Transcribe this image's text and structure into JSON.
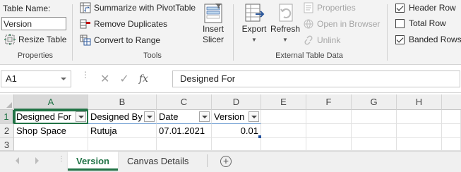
{
  "ribbon": {
    "properties": {
      "table_name_label": "Table Name:",
      "table_name_value": "Version",
      "resize_table": "Resize Table",
      "group_label": "Properties"
    },
    "tools": {
      "summarize_pivot": "Summarize with PivotTable",
      "remove_duplicates": "Remove Duplicates",
      "convert_to_range": "Convert to Range",
      "insert_slicer_line1": "Insert",
      "insert_slicer_line2": "Slicer",
      "group_label": "Tools"
    },
    "external": {
      "export": "Export",
      "refresh": "Refresh",
      "properties": "Properties",
      "open_in_browser": "Open in Browser",
      "unlink": "Unlink",
      "group_label": "External Table Data"
    },
    "style_options": {
      "header_row": {
        "label": "Header Row",
        "checked": true
      },
      "total_row": {
        "label": "Total Row",
        "checked": false
      },
      "banded_rows": {
        "label": "Banded Rows",
        "checked": true
      }
    }
  },
  "formula_bar": {
    "name_box": "A1",
    "fx_symbol": "fx",
    "cancel_symbol": "✕",
    "enter_symbol": "✓",
    "content": "Designed For"
  },
  "grid": {
    "columns": [
      "A",
      "B",
      "C",
      "D",
      "E",
      "F",
      "G",
      "H"
    ],
    "rows": [
      "1",
      "2",
      "3"
    ],
    "header_row": [
      "Designed For",
      "Designed By",
      "Date",
      "Version"
    ],
    "data_row": [
      "Shop Space",
      "Rutuja",
      "07.01.2021",
      "0.01"
    ]
  },
  "sheets": {
    "tabs": [
      "Version",
      "Canvas Details"
    ],
    "active": "Version",
    "add_symbol": "+"
  },
  "colors": {
    "accent": "#217346",
    "table_border": "#6b9bd1"
  }
}
